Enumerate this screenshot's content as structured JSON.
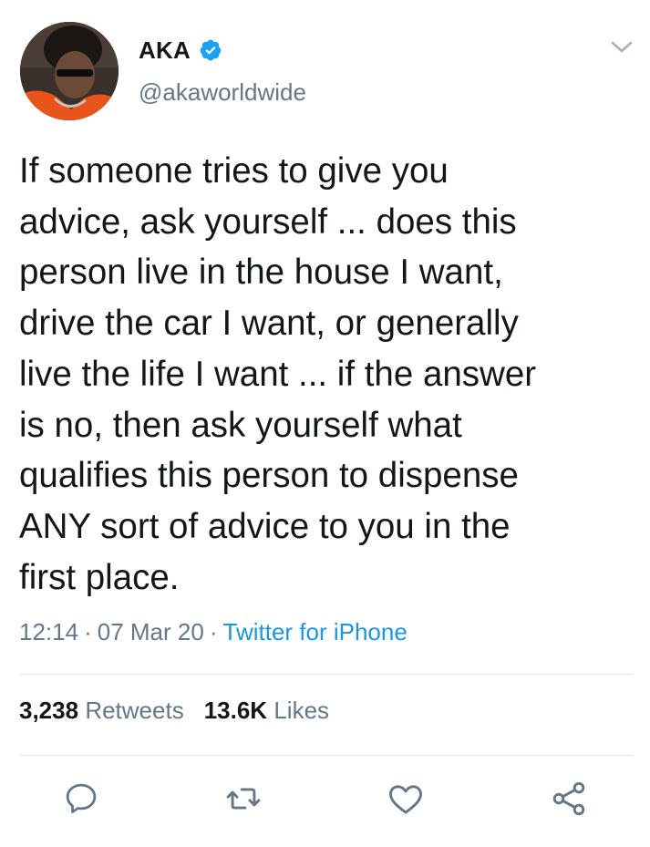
{
  "user": {
    "display_name": "AKA",
    "handle": "@akaworldwide",
    "verified": true,
    "avatar": "profile-photo"
  },
  "tweet": {
    "text": "If someone tries to give you\nadvice, ask yourself ... does this\nperson live in the house I want,\ndrive the car I want, or generally\nlive the life I want ... if the answer\nis no, then ask yourself what\nqualifies this person to dispense\nANY sort of advice to you in the\nfirst place.",
    "time": "12:14",
    "date": "07 Mar 20",
    "separator": "·",
    "source": "Twitter for iPhone"
  },
  "stats": {
    "retweets_count": "3,238",
    "retweets_label": "Retweets",
    "likes_count": "13.6K",
    "likes_label": "Likes"
  },
  "actions": {
    "reply": "reply-icon",
    "retweet": "retweet-icon",
    "like": "heart-icon",
    "share": "share-icon"
  },
  "colors": {
    "text": "#14171a",
    "secondary": "#657786",
    "accent": "#1b95e0",
    "verified": "#1da1f2",
    "divider": "#e1e8ed"
  }
}
